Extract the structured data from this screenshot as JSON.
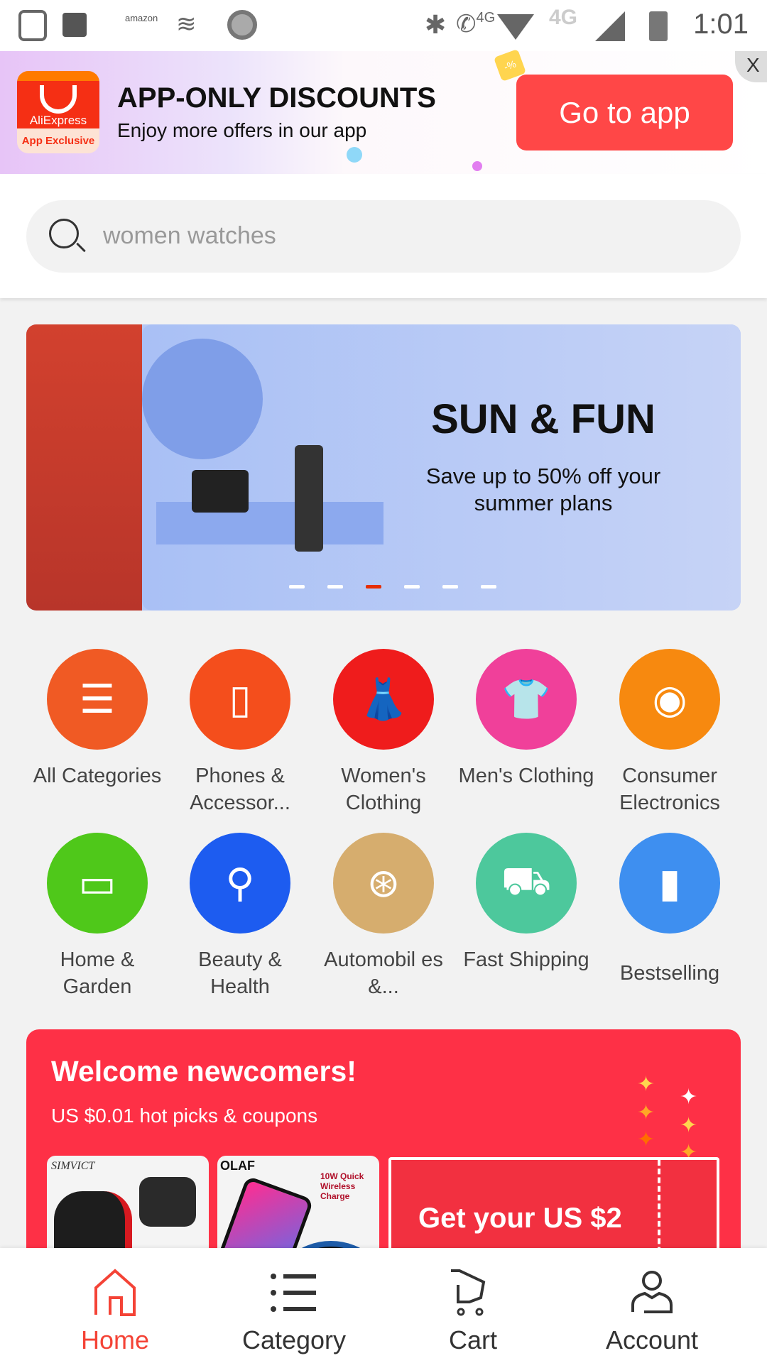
{
  "status_bar": {
    "time": "1:01",
    "network_1": "4G",
    "network_2": "4G",
    "amazon_label": "amazon",
    "icons": [
      "saavn-icon",
      "notes-icon",
      "amazon-icon",
      "audible-icon",
      "record-icon",
      "bluetooth-icon",
      "volte-call-icon",
      "wifi-icon",
      "signal-icon",
      "battery-charging-icon"
    ]
  },
  "promo": {
    "logo_text": "AliExpress",
    "logo_badge": "App Exclusive",
    "title": "APP-ONLY DISCOUNTS",
    "subtitle": "Enjoy more offers in our app",
    "button": "Go to app",
    "close": "X",
    "badge": "-%"
  },
  "search": {
    "placeholder": "women watches"
  },
  "carousel": {
    "title": "SUN & FUN",
    "subtitle": "Save up to 50% off your summer plans",
    "slides": 6,
    "active_slide": 3
  },
  "categories": [
    {
      "label": "All Categories",
      "color": "#f05a24",
      "icon": "list-icon"
    },
    {
      "label": "Phones & Accessor...",
      "color": "#f44e1c",
      "icon": "phone-icon"
    },
    {
      "label": "Women's Clothing",
      "color": "#ef1c1c",
      "icon": "dress-icon"
    },
    {
      "label": "Men's Clothing",
      "color": "#f0409a",
      "icon": "tshirt-icon"
    },
    {
      "label": "Consumer Electronics",
      "color": "#f7890f",
      "icon": "camera-icon"
    },
    {
      "label": "Home & Garden",
      "color": "#4fc81a",
      "icon": "sofa-icon"
    },
    {
      "label": "Beauty & Health",
      "color": "#1d5cf0",
      "icon": "mirror-icon"
    },
    {
      "label": "Automobil es &...",
      "color": "#d6ad6e",
      "icon": "wheel-icon"
    },
    {
      "label": "Fast Shipping",
      "color": "#4dc89c",
      "icon": "truck-icon"
    },
    {
      "label": "Bestselling",
      "color": "#3e8ff0",
      "icon": "bar-chart-icon"
    }
  ],
  "newcomers": {
    "title": "Welcome newcomers!",
    "subtitle": "US $0.01 hot picks & coupons",
    "products": [
      {
        "brand": "SIMVICT"
      },
      {
        "brand": "OLAF",
        "tag": "10W Quick Wireless Charge"
      }
    ],
    "coupon": "Get your US $2"
  },
  "nav": [
    {
      "label": "Home",
      "active": true
    },
    {
      "label": "Category"
    },
    {
      "label": "Cart"
    },
    {
      "label": "Account"
    }
  ],
  "colors": {
    "accent": "#ff4747",
    "newcomer_bg": "#fe3046",
    "nav_active": "#f44336"
  }
}
